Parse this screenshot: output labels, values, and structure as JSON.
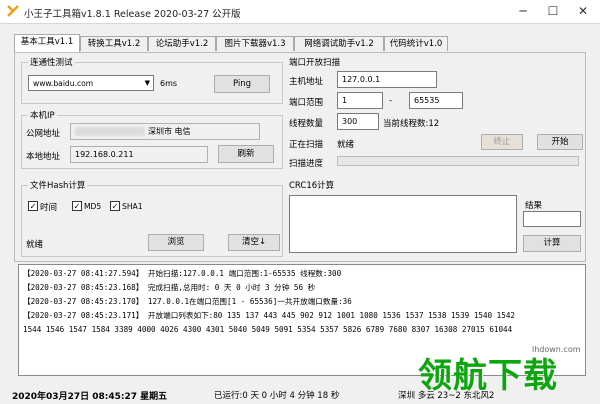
{
  "window": {
    "title": "小王子工具箱v1.8.1 Release 2020-03-27 公开版"
  },
  "tabs": [
    "基本工具v1.1",
    "转换工具v1.2",
    "论坛助手v1.2",
    "图片下载器v1.3",
    "网络调试助手v1.2",
    "代码统计v1.0"
  ],
  "connectivity": {
    "title": "连通性测试",
    "host": "www.baidu.com",
    "latency": "6ms",
    "ping": "Ping"
  },
  "local_ip": {
    "title": "本机IP",
    "public_label": "公网地址",
    "public_value": "深圳市 电信",
    "local_label": "本地地址",
    "local_value": "192.168.0.211",
    "refresh": "刷新"
  },
  "port_scan": {
    "title": "端口开放扫描",
    "host_label": "主机地址",
    "host_value": "127.0.0.1",
    "range_label": "端口范围",
    "range_start": "1",
    "range_sep": "-",
    "range_end": "65535",
    "threads_label": "线程数量",
    "threads_value": "300",
    "current_threads": "当前线程数:12",
    "scanning_label": "正在扫描",
    "scanning_status": "就绪",
    "stop": "终止",
    "start": "开始",
    "progress_label": "扫描进度",
    "progress": 0
  },
  "hash": {
    "title": "文件Hash计算",
    "opt_time": "时间",
    "opt_md5": "MD5",
    "opt_sha1": "SHA1",
    "status": "就绪",
    "browse": "浏览",
    "clear": "清空↓"
  },
  "crc": {
    "title": "CRC16计算",
    "result_label": "结果",
    "calc": "计算"
  },
  "log": [
    "【2020-03-27 08:41:27.594】 开始扫描:127.0.0.1 端口范围:1-65535 线程数:300",
    "【2020-03-27 08:45:23.168】 完成扫描,总用时: 0 天 0 小时 3 分钟 56 秒",
    "【2020-03-27 08:45:23.170】 127.0.0.1在端口范围[1 - 65536]一共开放端口数量:36",
    "【2020-03-27 08:45:23.171】 开放端口列表如下:80 135 137 443 445 902 912 1001 1080 1536 1537 1538 1539 1540 1542",
    "1544 1546 1547 1584 3389 4000 4026 4300 4301 5040 5049 5091 5354 5357 5826 6789 7680 8307 16308 27015 61044"
  ],
  "status": {
    "datetime": "2020年03月27日  08:45:27  星期五",
    "runtime": "已运行:0 天 0 小时 4 分钟 18 秒",
    "location": "深圳 多云 23~2 东北风2"
  },
  "watermark": {
    "text": "领航下载",
    "url": "lhdown.com"
  },
  "colors": {
    "accent": "#0ea60e",
    "icon": "#e8a317"
  }
}
